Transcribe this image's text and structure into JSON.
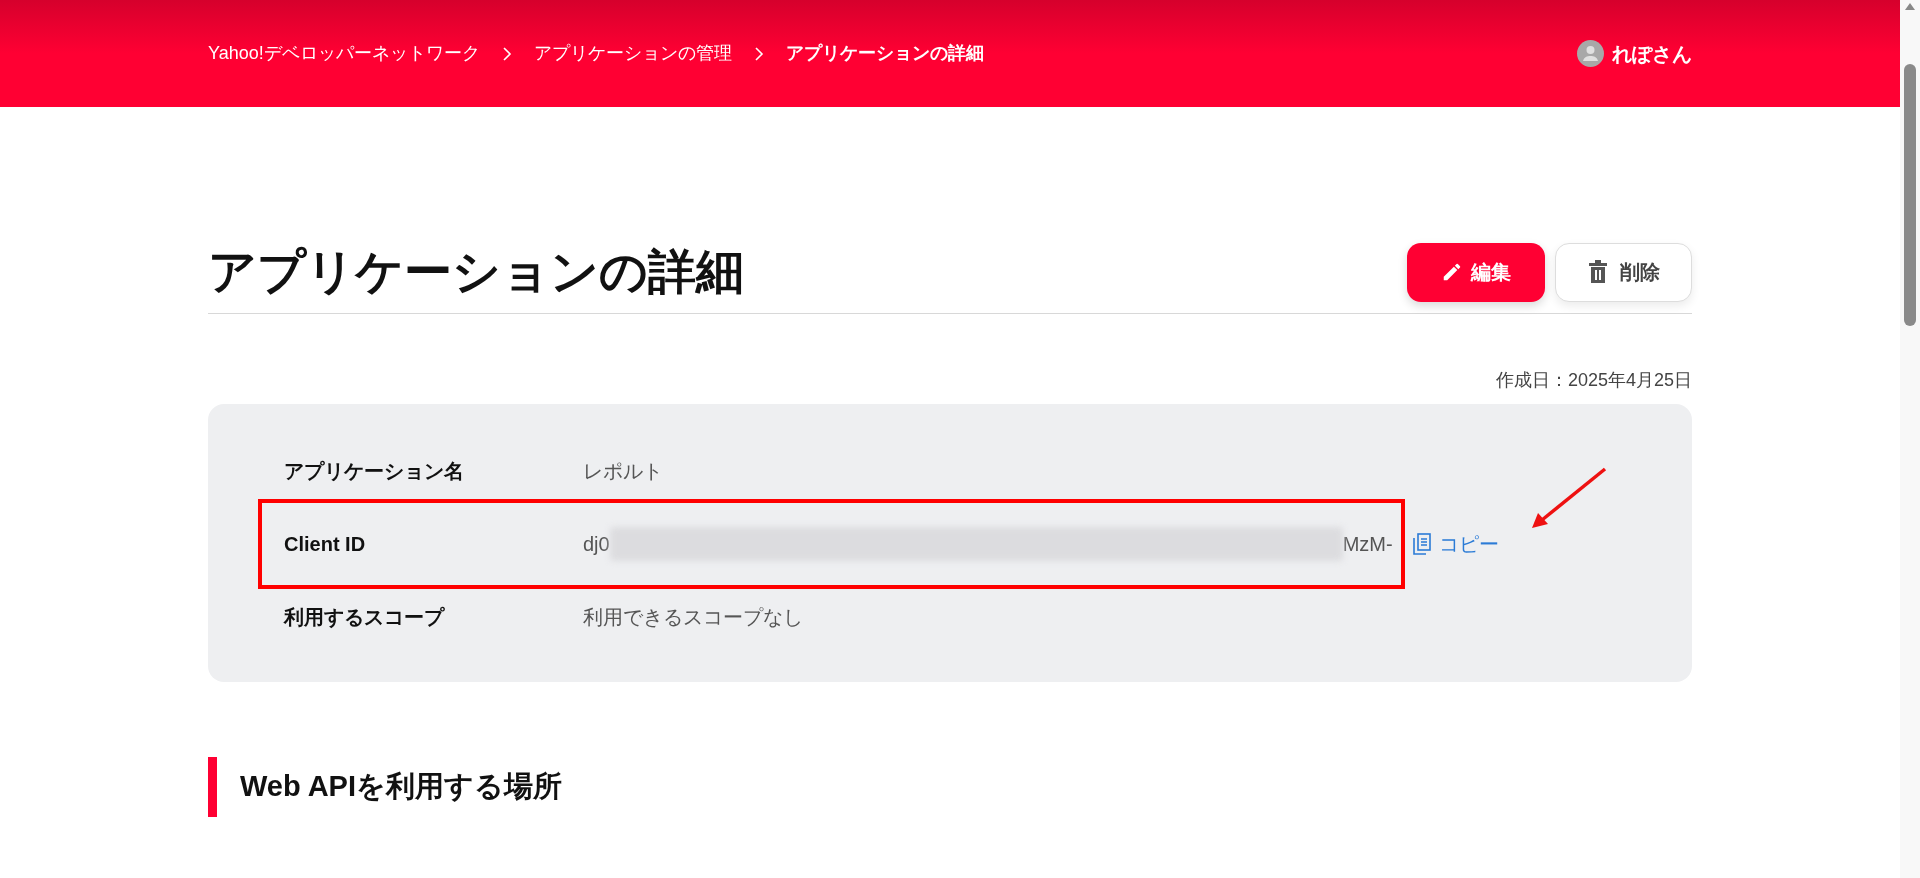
{
  "header": {
    "breadcrumbs": [
      {
        "label": "Yahoo!デベロッパーネットワーク",
        "current": false
      },
      {
        "label": "アプリケーションの管理",
        "current": false
      },
      {
        "label": "アプリケーションの詳細",
        "current": true
      }
    ],
    "user": {
      "name": "れぽさん"
    }
  },
  "page": {
    "title": "アプリケーションの詳細",
    "actions": [
      {
        "kind": "edit",
        "label": "編集"
      },
      {
        "kind": "delete",
        "label": "削除"
      }
    ],
    "created": "作成日：2025年4月25日"
  },
  "details": [
    {
      "label": "アプリケーション名",
      "value": "レポルト",
      "highlighted": false
    },
    {
      "label": "Client ID",
      "value": "dj0",
      "value_end": "MzM-",
      "redacted": true,
      "highlighted": true,
      "copy_label": "コピー"
    },
    {
      "label": "利用するスコープ",
      "value": "利用できるスコープなし",
      "highlighted": false
    }
  ],
  "section": {
    "title": "Web APIを利用する場所"
  }
}
